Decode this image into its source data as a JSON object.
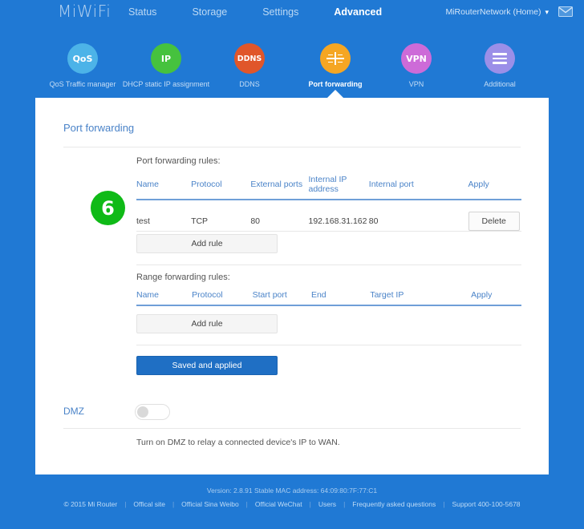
{
  "header": {
    "logo": "MiWiFi",
    "nav": [
      {
        "label": "Status",
        "active": false
      },
      {
        "label": "Storage",
        "active": false
      },
      {
        "label": "Settings",
        "active": false
      },
      {
        "label": "Advanced",
        "active": true
      }
    ],
    "network_selector": "MiRouterNetwork (Home)",
    "caret": "chevron-down-icon",
    "mail": "mail-icon"
  },
  "icon_nav": [
    {
      "label": "QoS Traffic manager",
      "glyph": "QoS",
      "color": "#4cb3e8",
      "active": false
    },
    {
      "label": "DHCP static IP assignment",
      "glyph": "IP",
      "color": "#46c23e",
      "active": false
    },
    {
      "label": "DDNS",
      "glyph": "DDNS",
      "color": "#e0562a",
      "active": false
    },
    {
      "label": "Port forwarding",
      "glyph": "port-forward-icon",
      "color": "#f5a623",
      "active": true
    },
    {
      "label": "VPN",
      "glyph": "VPN",
      "color": "#cd6bd8",
      "active": false
    },
    {
      "label": "Additional",
      "glyph": "hamburger-icon",
      "color": "#9b8fe8",
      "active": false
    }
  ],
  "card": {
    "title": "Port forwarding",
    "step_badge": "6",
    "port_forwarding": {
      "section_label": "Port forwarding rules:",
      "columns": [
        "Name",
        "Protocol",
        "External ports",
        "Internal IP address",
        "Internal port",
        "Apply"
      ],
      "rows": [
        {
          "name": "test",
          "protocol": "TCP",
          "external_ports": "80",
          "internal_ip": "192.168.31.162",
          "internal_port": "80",
          "action": "Delete"
        }
      ],
      "add_rule_label": "Add rule"
    },
    "range_forwarding": {
      "section_label": "Range forwarding rules:",
      "columns": [
        "Name",
        "Protocol",
        "Start port",
        "End",
        "Target IP",
        "Apply"
      ],
      "rows": [],
      "add_rule_label": "Add rule"
    },
    "save_button_label": "Saved and applied",
    "dmz": {
      "label": "DMZ",
      "toggle_state": "off",
      "help_text": "Turn on DMZ to relay a connected device's IP to WAN."
    }
  },
  "footer": {
    "version_line": "Version: 2.8.91 Stable  MAC address: 64:09:80:7F:77:C1",
    "links": [
      "© 2015 Mi Router",
      "Offical site",
      "Official Sina Weibo",
      "Official WeChat",
      "Users",
      "Frequently asked questions",
      "Support 400-100-5678"
    ]
  },
  "colors": {
    "brand_blue": "#2079d4",
    "accent_link": "#4a83c8",
    "badge_green": "#0fba17",
    "primary_button": "#1f6fc4"
  }
}
